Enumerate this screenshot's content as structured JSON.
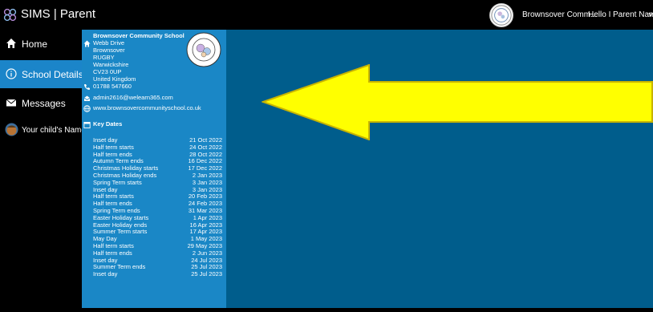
{
  "app": {
    "title": "SIMS | Parent"
  },
  "header": {
    "school_name": "Brownsover Comm...",
    "hello": "Hello I",
    "parent_name": "Parent Name"
  },
  "nav": [
    {
      "label": "Home",
      "icon": "home-icon"
    },
    {
      "label": "School Details",
      "icon": "info-icon"
    },
    {
      "label": "Messages",
      "icon": "mail-icon"
    },
    {
      "label": "Your child's Name",
      "icon": "child-avatar"
    }
  ],
  "school": {
    "name": "Brownsover Community School",
    "address": [
      "Webb Drive",
      "Brownsover",
      "RUGBY",
      "Warwickshire",
      "CV23 0UP",
      "United Kingdom"
    ],
    "phone": "01788 547660",
    "email": "admin2616@welearn365.com",
    "website": "www.brownsovercommunityschool.co.uk"
  },
  "key_dates": {
    "title": "Key Dates",
    "items": [
      {
        "label": "Inset day",
        "date": "21 Oct 2022"
      },
      {
        "label": "Half term starts",
        "date": "24 Oct 2022"
      },
      {
        "label": "Half term ends",
        "date": "28 Oct 2022"
      },
      {
        "label": "Autumn Term ends",
        "date": "16 Dec 2022"
      },
      {
        "label": "Christmas Holiday starts",
        "date": "17 Dec 2022"
      },
      {
        "label": "Christmas Holiday ends",
        "date": "2 Jan 2023"
      },
      {
        "label": "Spring Term starts",
        "date": "3 Jan 2023"
      },
      {
        "label": "Inset day",
        "date": "3 Jan 2023"
      },
      {
        "label": "Half term starts",
        "date": "20 Feb 2023"
      },
      {
        "label": "Half term ends",
        "date": "24 Feb 2023"
      },
      {
        "label": "Spring Term ends",
        "date": "31 Mar 2023"
      },
      {
        "label": "Easter Holiday starts",
        "date": "1 Apr 2023"
      },
      {
        "label": "Easter Holiday ends",
        "date": "16 Apr 2023"
      },
      {
        "label": "Summer Term starts",
        "date": "17 Apr 2023"
      },
      {
        "label": "May Day",
        "date": "1 May 2023"
      },
      {
        "label": "Half term starts",
        "date": "29 May 2023"
      },
      {
        "label": "Half term ends",
        "date": "2 Jun 2023"
      },
      {
        "label": "Inset day",
        "date": "24 Jul 2023"
      },
      {
        "label": "Summer Term ends",
        "date": "25 Jul 2023"
      },
      {
        "label": "Inset day",
        "date": "25 Jul 2023"
      }
    ]
  },
  "colors": {
    "nav_active": "#1b85c9",
    "panel": "#1a87c6",
    "main": "#005d8c",
    "arrow_fill": "#ffff00",
    "arrow_stroke": "#c8b400"
  }
}
